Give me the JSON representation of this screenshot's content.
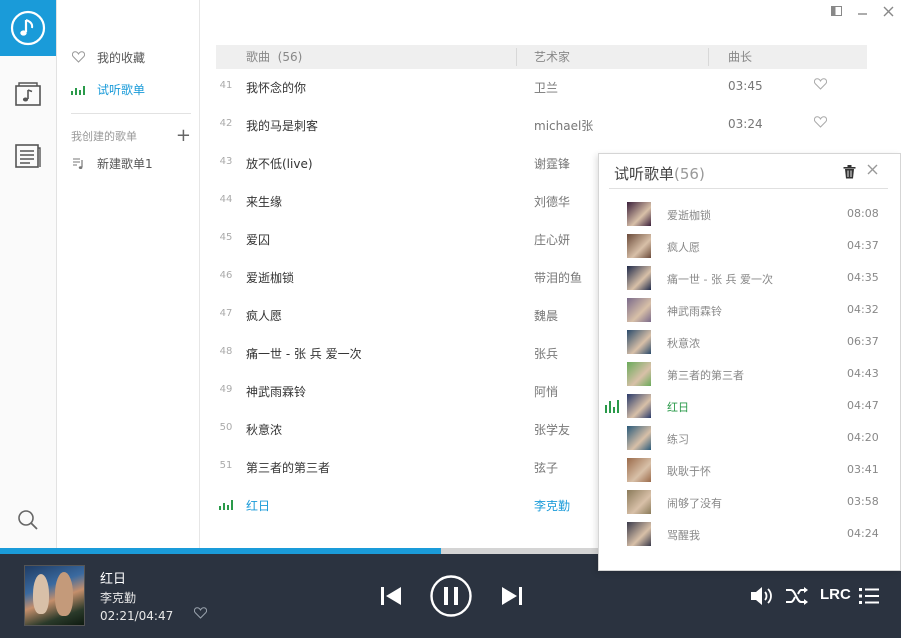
{
  "window_controls": [
    "restore-icon",
    "minimize-icon",
    "close-icon"
  ],
  "sidebar": {
    "favorites_label": "我的收藏",
    "trial_label": "试听歌单",
    "section_label": "我创建的歌单",
    "new_playlist_label": "新建歌单1"
  },
  "table": {
    "col_song": "歌曲",
    "col_song_count": "(56)",
    "col_artist": "艺术家",
    "col_duration": "曲长",
    "rows": [
      {
        "num": "41",
        "title": "我怀念的你",
        "artist": "卫兰",
        "duration": "03:45",
        "fav": true
      },
      {
        "num": "42",
        "title": "我的马是刺客",
        "artist": "michael张",
        "duration": "03:24",
        "fav": true
      },
      {
        "num": "43",
        "title": "放不低(live)",
        "artist": "谢霆锋",
        "duration": "",
        "fav": false
      },
      {
        "num": "44",
        "title": "来生缘",
        "artist": "刘德华",
        "duration": "",
        "fav": false
      },
      {
        "num": "45",
        "title": "爱囚",
        "artist": "庄心妍",
        "duration": "",
        "fav": false
      },
      {
        "num": "46",
        "title": "爱逝枷锁",
        "artist": "带泪的鱼",
        "duration": "",
        "fav": false
      },
      {
        "num": "47",
        "title": "疯人愿",
        "artist": "魏晨",
        "duration": "",
        "fav": false
      },
      {
        "num": "48",
        "title": "痛一世 - 张 兵 爱一次",
        "artist": "张兵",
        "duration": "",
        "fav": false
      },
      {
        "num": "49",
        "title": "神武雨霖铃",
        "artist": "阿悄",
        "duration": "",
        "fav": false
      },
      {
        "num": "50",
        "title": "秋意浓",
        "artist": "张学友",
        "duration": "",
        "fav": false
      },
      {
        "num": "51",
        "title": "第三者的第三者",
        "artist": "弦子",
        "duration": "",
        "fav": false
      },
      {
        "num": "",
        "title": "红日",
        "artist": "李克勤",
        "duration": "",
        "fav": false,
        "playing": true
      }
    ]
  },
  "progress": {
    "fraction": 0.49
  },
  "player": {
    "title": "红日",
    "artist": "李克勤",
    "time": "02:21/04:47",
    "lrc_label": "LRC"
  },
  "popup": {
    "title": "试听歌单",
    "count": "(56)",
    "items": [
      {
        "name": "爱逝枷锁",
        "duration": "08:08",
        "thumb": "#3a1f3a"
      },
      {
        "name": "疯人愿",
        "duration": "04:37",
        "thumb": "#6a4a3a"
      },
      {
        "name": "痛一世 - 张 兵 爱一次",
        "duration": "04:35",
        "thumb": "#1f2a4a"
      },
      {
        "name": "神武雨霖铃",
        "duration": "04:32",
        "thumb": "#7a6a8a"
      },
      {
        "name": "秋意浓",
        "duration": "06:37",
        "thumb": "#2a4a6a"
      },
      {
        "name": "第三者的第三者",
        "duration": "04:43",
        "thumb": "#6aaa5a"
      },
      {
        "name": "红日",
        "duration": "04:47",
        "thumb": "#2a3a6a",
        "playing": true
      },
      {
        "name": "练习",
        "duration": "04:20",
        "thumb": "#2a5a7a"
      },
      {
        "name": "耿耿于怀",
        "duration": "03:41",
        "thumb": "#9a6a4a"
      },
      {
        "name": "闹够了没有",
        "duration": "03:58",
        "thumb": "#8a7a5a"
      },
      {
        "name": "骂醒我",
        "duration": "04:24",
        "thumb": "#3a3a4a"
      }
    ]
  },
  "colors": {
    "accent": "#1a9bd9",
    "player_bg": "#2b3340",
    "eq_green": "#2a9a4a"
  }
}
